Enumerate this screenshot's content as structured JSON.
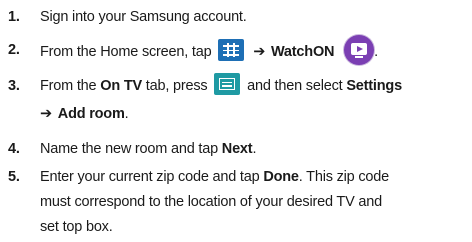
{
  "steps": [
    {
      "num": "1.",
      "text": "Sign into your Samsung account."
    },
    {
      "num": "2.",
      "prefix": "From the Home screen, tap",
      "arrow": "➔",
      "app_name": "WatchON",
      "suffix": "."
    },
    {
      "num": "3.",
      "p1": "From the ",
      "b1": "On TV",
      "p2": " tab, press",
      "p3": "and then select ",
      "b2": "Settings",
      "arrow": "➔",
      "b3": "Add room",
      "end": "."
    },
    {
      "num": "4.",
      "p1": "Name the new room and tap ",
      "b1": "Next",
      "end": "."
    },
    {
      "num": "5.",
      "p1": "Enter your current zip code and tap ",
      "b1": "Done",
      "line1_end": ". This zip code",
      "line2": "must correspond to the location of your desired TV and",
      "line3": "set top box."
    }
  ],
  "icons": {
    "apps": "apps-grid-icon",
    "watchon": "watchon-app-icon",
    "menu": "menu-key-icon"
  },
  "colors": {
    "apps_icon": "#1e6fb5",
    "watchon_icon": "#7b3fb3",
    "menu_icon": "#1f9aa3"
  }
}
